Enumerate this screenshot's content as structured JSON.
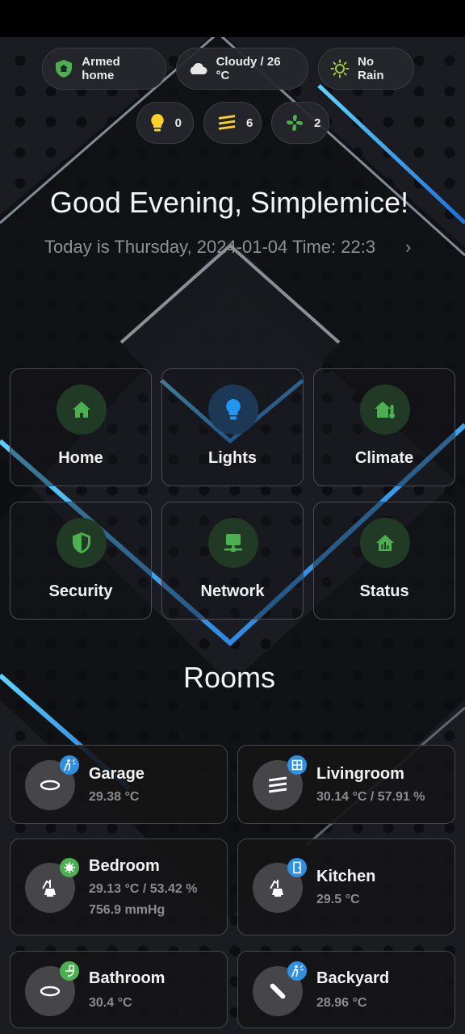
{
  "status_chips": {
    "alarm": "Armed home",
    "weather": "Cloudy / 26 °C",
    "rain": "No Rain"
  },
  "counters": {
    "lights": "0",
    "covers": "6",
    "fans": "2"
  },
  "greeting": "Good Evening, Simplemice!",
  "date_line": "Today is Thursday, 2024-01-04 Time: 22:3",
  "nav_tiles": [
    "Home",
    "Lights",
    "Climate",
    "Security",
    "Network",
    "Status"
  ],
  "rooms_title": "Rooms",
  "rooms": [
    {
      "name": "Garage",
      "state": "29.38 °C",
      "icon": "ceiling-light-icon",
      "badge": "motion-icon",
      "badge_color": "#2f8fe0"
    },
    {
      "name": "Livingroom",
      "state": "30.14 °C / 57.91 %",
      "icon": "blinds-icon",
      "badge": "window-icon",
      "badge_color": "#2f8fe0"
    },
    {
      "name": "Bedroom",
      "state": "29.13 °C / 53.42 %",
      "state2": "756.9 mmHg",
      "icon": "desk-lamp-icon",
      "badge": "virus-icon",
      "badge_color": "#4caf50"
    },
    {
      "name": "Kitchen",
      "state": "29.5 °C",
      "icon": "desk-lamp-icon",
      "badge": "door-icon",
      "badge_color": "#2f8fe0"
    },
    {
      "name": "Bathroom",
      "state": "30.4 °C",
      "icon": "ceiling-light-icon",
      "badge": "toilet-icon",
      "badge_color": "#4caf50"
    },
    {
      "name": "Backyard",
      "state": "28.96 °C",
      "icon": "light-tube-icon",
      "badge": "motion-icon",
      "badge_color": "#2f8fe0"
    }
  ],
  "colors": {
    "accent_green": "#4caf50",
    "accent_blue": "#2196f3",
    "light_yellow": "#ffd02a"
  }
}
